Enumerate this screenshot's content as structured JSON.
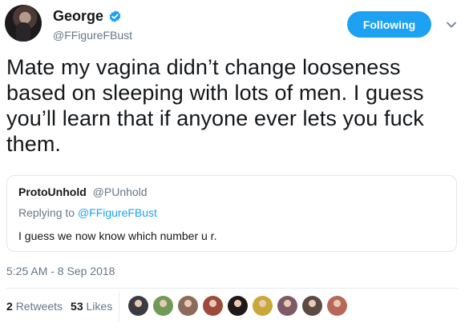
{
  "author": {
    "display_name": "George",
    "handle": "@FFigureFBust",
    "verified": true
  },
  "follow_button": {
    "label": "Following",
    "color": "#1da1f2"
  },
  "tweet": {
    "lines": [
      "Mate my vagina didn’t change looseness",
      "based on sleeping with lots of men. I guess",
      "you’ll learn that if anyone ever lets you fuck",
      "them."
    ]
  },
  "quoted_tweet": {
    "author_name": "ProtoUnhold",
    "author_handle": "@PUnhold",
    "replying_prefix": "Replying to",
    "replying_to": "@FFigureFBust",
    "text": "I guess we now know which number u r."
  },
  "timestamp": "5:25 AM - 8 Sep 2018",
  "stats": {
    "retweets_count": "2",
    "retweets_label": "Retweets",
    "likes_count": "53",
    "likes_label": "Likes"
  },
  "liker_avatars": [
    {
      "icon": "liker-avatar-icon",
      "color": "#3b3b44"
    },
    {
      "icon": "liker-avatar-icon",
      "color": "#6f9a58"
    },
    {
      "icon": "liker-avatar-icon",
      "color": "#8a6b5c"
    },
    {
      "icon": "liker-avatar-icon",
      "color": "#9c4a3c"
    },
    {
      "icon": "liker-avatar-icon",
      "color": "#1e1a1a"
    },
    {
      "icon": "liker-avatar-icon",
      "color": "#c9a83a"
    },
    {
      "icon": "liker-avatar-icon",
      "color": "#7d5a66"
    },
    {
      "icon": "liker-avatar-icon",
      "color": "#5a4a44"
    },
    {
      "icon": "liker-avatar-icon",
      "color": "#b7685a"
    }
  ],
  "colors": {
    "accent": "#1da1f2",
    "secondary_text": "#657786",
    "primary_text": "#14171a",
    "border": "#e1e8ed"
  }
}
